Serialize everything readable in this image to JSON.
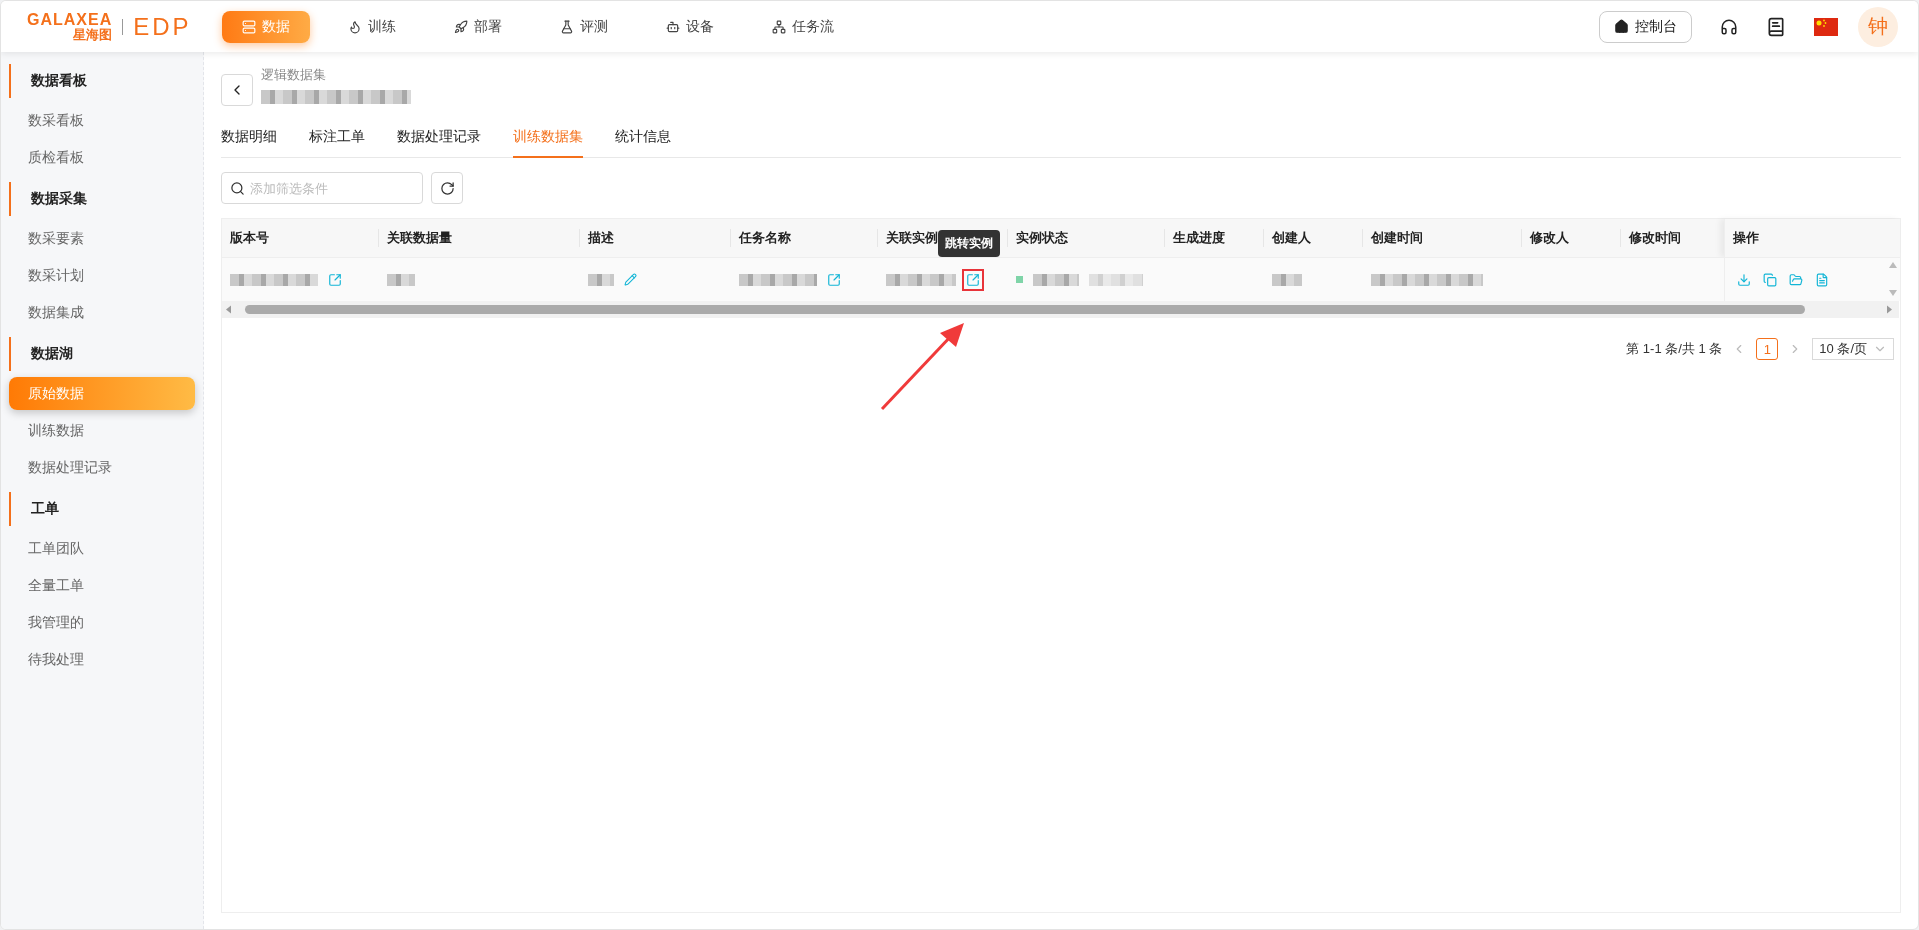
{
  "logo": {
    "brand": "GALAXEA",
    "brand_cn": "星海图",
    "product": "EDP"
  },
  "nav": [
    {
      "label": "数据",
      "selected": true
    },
    {
      "label": "训练",
      "selected": false
    },
    {
      "label": "部署",
      "selected": false
    },
    {
      "label": "评测",
      "selected": false
    },
    {
      "label": "设备",
      "selected": false
    },
    {
      "label": "任务流",
      "selected": false
    }
  ],
  "header_right": {
    "console": "控制台",
    "avatar": "钟"
  },
  "sidebar": [
    {
      "title": "数据看板",
      "items": [
        {
          "label": "数采看板",
          "selected": false
        },
        {
          "label": "质检看板",
          "selected": false
        }
      ]
    },
    {
      "title": "数据采集",
      "items": [
        {
          "label": "数采要素",
          "selected": false
        },
        {
          "label": "数采计划",
          "selected": false
        },
        {
          "label": "数据集成",
          "selected": false
        }
      ]
    },
    {
      "title": "数据湖",
      "items": [
        {
          "label": "原始数据",
          "selected": true
        },
        {
          "label": "训练数据",
          "selected": false
        },
        {
          "label": "数据处理记录",
          "selected": false
        }
      ]
    },
    {
      "title": "工单",
      "items": [
        {
          "label": "工单团队",
          "selected": false
        },
        {
          "label": "全量工单",
          "selected": false
        },
        {
          "label": "我管理的",
          "selected": false
        },
        {
          "label": "待我处理",
          "selected": false
        }
      ]
    }
  ],
  "breadcrumb": "逻辑数据集",
  "tabs": [
    {
      "label": "数据明细",
      "selected": false
    },
    {
      "label": "标注工单",
      "selected": false
    },
    {
      "label": "数据处理记录",
      "selected": false
    },
    {
      "label": "训练数据集",
      "selected": true
    },
    {
      "label": "统计信息",
      "selected": false
    }
  ],
  "search": {
    "placeholder": "添加筛选条件"
  },
  "table": {
    "columns": [
      "版本号",
      "关联数据量",
      "描述",
      "任务名称",
      "关联实例",
      "实例状态",
      "生成进度",
      "创建人",
      "创建时间",
      "修改人",
      "修改时间",
      "操作"
    ],
    "row": [
      {
        "kind": "redacted",
        "link": true,
        "highlighted": false
      },
      {
        "kind": "redacted"
      },
      {
        "kind": "redacted",
        "edit": true
      },
      {
        "kind": "redacted",
        "link": true,
        "highlighted": false
      },
      {
        "kind": "redacted",
        "link": true,
        "highlighted": true
      },
      {
        "kind": "status",
        "color": "#7fd4a8"
      },
      {
        "kind": "empty"
      },
      {
        "kind": "redacted"
      },
      {
        "kind": "redacted"
      },
      {
        "kind": "empty"
      },
      {
        "kind": "empty"
      },
      {
        "kind": "actions"
      }
    ]
  },
  "tooltip": "跳转实例",
  "pagination": {
    "summary": "第 1-1 条/共 1 条",
    "pages": [
      {
        "label": "1",
        "selected": true
      }
    ],
    "page_size": "10 条/页"
  }
}
